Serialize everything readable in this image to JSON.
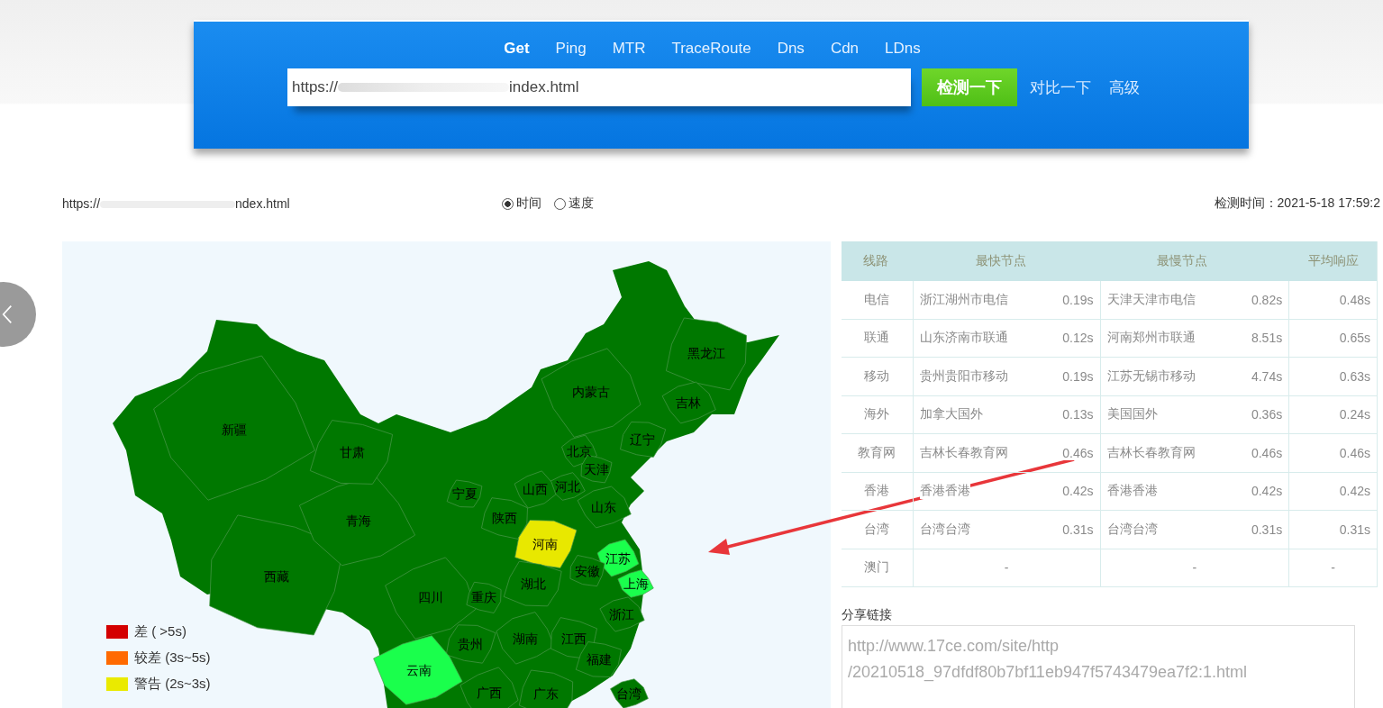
{
  "search_panel": {
    "tabs": [
      {
        "label": "Get",
        "selected": true
      },
      {
        "label": "Ping",
        "selected": false
      },
      {
        "label": "MTR",
        "selected": false
      },
      {
        "label": "TraceRoute",
        "selected": false
      },
      {
        "label": "Dns",
        "selected": false
      },
      {
        "label": "Cdn",
        "selected": false
      },
      {
        "label": "LDns",
        "selected": false
      }
    ],
    "url_prefix": "https://",
    "url_suffix": "index.html",
    "submit_button": "检测一下",
    "links": [
      "对比一下",
      "高级"
    ]
  },
  "result_bar": {
    "url_prefix": "https://",
    "url_suffix": "ndex.html",
    "radios": [
      {
        "label": "时间",
        "selected": true
      },
      {
        "label": "速度",
        "selected": false
      }
    ],
    "check_time": "检测时间：2021-5-18 17:59:2"
  },
  "map": {
    "provinces": [
      {
        "name": "新疆",
        "color": "#007800"
      },
      {
        "name": "西藏",
        "color": "#007800"
      },
      {
        "name": "青海",
        "color": "#007800"
      },
      {
        "name": "甘肃",
        "color": "#007800"
      },
      {
        "name": "内蒙古",
        "color": "#007800"
      },
      {
        "name": "黑龙江",
        "color": "#007800"
      },
      {
        "name": "吉林",
        "color": "#007800"
      },
      {
        "name": "辽宁",
        "color": "#007800"
      },
      {
        "name": "北京",
        "color": "#007800"
      },
      {
        "name": "天津",
        "color": "#007800"
      },
      {
        "name": "河北",
        "color": "#007800"
      },
      {
        "name": "宁夏",
        "color": "#007800"
      },
      {
        "name": "山西",
        "color": "#007800"
      },
      {
        "name": "陕西",
        "color": "#007800"
      },
      {
        "name": "山东",
        "color": "#007800"
      },
      {
        "name": "河南",
        "color": "#e8e800"
      },
      {
        "name": "江苏",
        "color": "#1aff4c"
      },
      {
        "name": "安徽",
        "color": "#007800"
      },
      {
        "name": "上海",
        "color": "#1aff4c"
      },
      {
        "name": "湖北",
        "color": "#007800"
      },
      {
        "name": "四川",
        "color": "#007800"
      },
      {
        "name": "重庆",
        "color": "#007800"
      },
      {
        "name": "浙江",
        "color": "#007800"
      },
      {
        "name": "贵州",
        "color": "#007800"
      },
      {
        "name": "湖南",
        "color": "#007800"
      },
      {
        "name": "江西",
        "color": "#007800"
      },
      {
        "name": "云南",
        "color": "#1aff4c"
      },
      {
        "name": "福建",
        "color": "#007800"
      },
      {
        "name": "广西",
        "color": "#007800"
      },
      {
        "name": "广东",
        "color": "#007800"
      },
      {
        "name": "台湾",
        "color": "#007800"
      }
    ],
    "legend": [
      {
        "label": "差 ( >5s)",
        "color": "#d40000"
      },
      {
        "label": "较差 (3s~5s)",
        "color": "#ff6a00"
      },
      {
        "label": "警告 (2s~3s)",
        "color": "#eaea00"
      }
    ]
  },
  "table": {
    "columns": [
      "线路",
      "最快节点",
      "最慢节点",
      "平均响应"
    ],
    "rows": [
      {
        "line": "电信",
        "fastest": {
          "node": "浙江湖州市电信",
          "time": "0.19s"
        },
        "slowest": {
          "node": "天津天津市电信",
          "time": "0.82s"
        },
        "average": "0.48s"
      },
      {
        "line": "联通",
        "fastest": {
          "node": "山东济南市联通",
          "time": "0.12s"
        },
        "slowest": {
          "node": "河南郑州市联通",
          "time": "8.51s"
        },
        "average": "0.65s"
      },
      {
        "line": "移动",
        "fastest": {
          "node": "贵州贵阳市移动",
          "time": "0.19s"
        },
        "slowest": {
          "node": "江苏无锡市移动",
          "time": "4.74s"
        },
        "average": "0.63s"
      },
      {
        "line": "海外",
        "fastest": {
          "node": "加拿大国外",
          "time": "0.13s"
        },
        "slowest": {
          "node": "美国国外",
          "time": "0.36s"
        },
        "average": "0.24s"
      },
      {
        "line": "教育网",
        "fastest": {
          "node": "吉林长春教育网",
          "time": "0.46s"
        },
        "slowest": {
          "node": "吉林长春教育网",
          "time": "0.46s"
        },
        "average": "0.46s"
      },
      {
        "line": "香港",
        "fastest": {
          "node": "香港香港",
          "time": "0.42s"
        },
        "slowest": {
          "node": "香港香港",
          "time": "0.42s"
        },
        "average": "0.42s"
      },
      {
        "line": "台湾",
        "fastest": {
          "node": "台湾台湾",
          "time": "0.31s"
        },
        "slowest": {
          "node": "台湾台湾",
          "time": "0.31s"
        },
        "average": "0.31s"
      },
      {
        "line": "澳门",
        "fastest": "-",
        "slowest": "-",
        "average": "-"
      }
    ]
  },
  "share": {
    "label": "分享链接",
    "lines": [
      "http://www.17ce.com/site/http",
      "/20210518_97dfdf80b7bf11eb947f5743479ea7f2:1.html"
    ]
  }
}
